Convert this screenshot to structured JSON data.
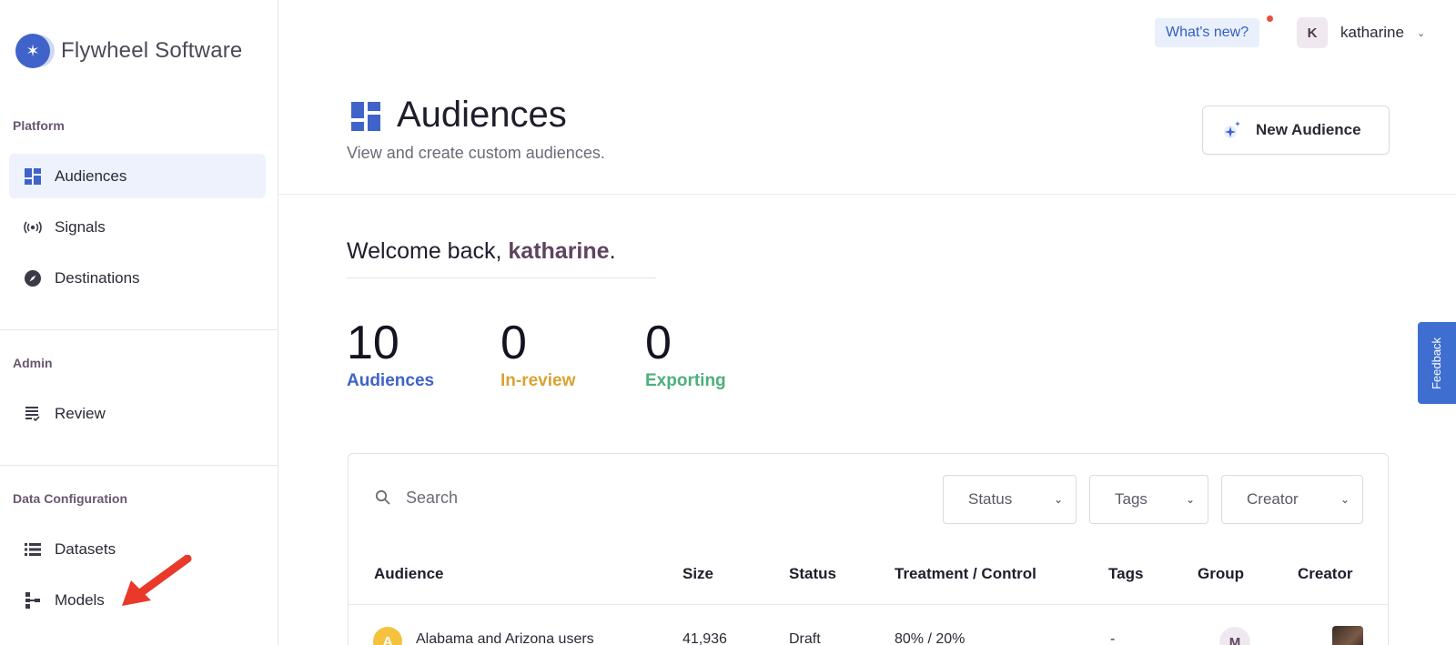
{
  "brand": {
    "name": "Flywheel Software"
  },
  "sidebar": {
    "sections": [
      {
        "label": "Platform"
      },
      {
        "label": "Admin"
      },
      {
        "label": "Data Configuration"
      }
    ],
    "items": [
      {
        "label": "Audiences",
        "icon": "grid-icon",
        "active": true
      },
      {
        "label": "Signals",
        "icon": "broadcast-icon"
      },
      {
        "label": "Destinations",
        "icon": "compass-icon"
      },
      {
        "label": "Review",
        "icon": "review-list-icon"
      },
      {
        "label": "Datasets",
        "icon": "list-icon"
      },
      {
        "label": "Models",
        "icon": "model-tree-icon"
      }
    ]
  },
  "topbar": {
    "whats_new": "What's new?",
    "user_initial": "K",
    "user_name": "katharine"
  },
  "header": {
    "title": "Audiences",
    "subtitle": "View and create custom audiences.",
    "new_audience_label": "New Audience"
  },
  "welcome": {
    "prefix": "Welcome back, ",
    "name": "katharine",
    "suffix": "."
  },
  "stats": [
    {
      "value": "10",
      "label": "Audiences",
      "color": "#3f63c9"
    },
    {
      "value": "0",
      "label": "In-review",
      "color": "#d9a233"
    },
    {
      "value": "0",
      "label": "Exporting",
      "color": "#4caf7d"
    }
  ],
  "feedback": {
    "label": "Feedback"
  },
  "table": {
    "search_placeholder": "Search",
    "filters": [
      "Status",
      "Tags",
      "Creator"
    ],
    "columns": [
      "Audience",
      "Size",
      "Status",
      "Treatment / Control",
      "Tags",
      "Group",
      "Creator"
    ],
    "rows": [
      {
        "initial": "A",
        "audience": "Alabama and Arizona users",
        "size": "41,936",
        "status": "Draft",
        "treatment_control": "80% / 20%",
        "tags": "-",
        "group": "M"
      }
    ]
  },
  "colors": {
    "accent": "#3f63c9",
    "annotation_arrow": "#e8392b"
  }
}
